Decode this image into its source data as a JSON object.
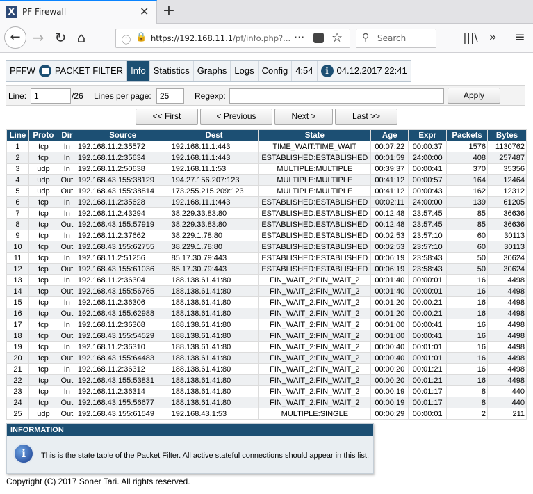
{
  "browser": {
    "tab_title": "PF Firewall",
    "url_host": "https://192.168.11.1",
    "url_path": "/pf/info.php?...",
    "search_placeholder": "Search"
  },
  "nav": {
    "brand": "PFFW",
    "menu_label": "PACKET FILTER",
    "tabs": [
      "Info",
      "Statistics",
      "Graphs",
      "Logs",
      "Config"
    ],
    "active_tab": "Info",
    "time": "4:54",
    "date": "04.12.2017 22:41"
  },
  "controls": {
    "line_label": "Line:",
    "line_value": "1",
    "line_total": "/26",
    "lines_per_page_label": "Lines per page:",
    "lines_per_page_value": "25",
    "regexp_label": "Regexp:",
    "regexp_value": "",
    "apply_label": "Apply"
  },
  "pager": {
    "first": "<< First",
    "previous": "< Previous",
    "next": "Next >",
    "last": "Last >>"
  },
  "table": {
    "headers": [
      "Line",
      "Proto",
      "Dir",
      "Source",
      "Dest",
      "State",
      "Age",
      "Expr",
      "Packets",
      "Bytes"
    ],
    "rows": [
      [
        "1",
        "tcp",
        "In",
        "192.168.11.2:35572",
        "192.168.11.1:443",
        "TIME_WAIT:TIME_WAIT",
        "00:07:22",
        "00:00:37",
        "1576",
        "1130762"
      ],
      [
        "2",
        "tcp",
        "In",
        "192.168.11.2:35634",
        "192.168.11.1:443",
        "ESTABLISHED:ESTABLISHED",
        "00:01:59",
        "24:00:00",
        "408",
        "257487"
      ],
      [
        "3",
        "udp",
        "In",
        "192.168.11.2:50638",
        "192.168.11.1:53",
        "MULTIPLE:MULTIPLE",
        "00:39:37",
        "00:00:41",
        "370",
        "35356"
      ],
      [
        "4",
        "udp",
        "Out",
        "192.168.43.155:38129",
        "194.27.156.207:123",
        "MULTIPLE:MULTIPLE",
        "00:41:12",
        "00:00:57",
        "164",
        "12464"
      ],
      [
        "5",
        "udp",
        "Out",
        "192.168.43.155:38814",
        "173.255.215.209:123",
        "MULTIPLE:MULTIPLE",
        "00:41:12",
        "00:00:43",
        "162",
        "12312"
      ],
      [
        "6",
        "tcp",
        "In",
        "192.168.11.2:35628",
        "192.168.11.1:443",
        "ESTABLISHED:ESTABLISHED",
        "00:02:11",
        "24:00:00",
        "139",
        "61205"
      ],
      [
        "7",
        "tcp",
        "In",
        "192.168.11.2:43294",
        "38.229.33.83:80",
        "ESTABLISHED:ESTABLISHED",
        "00:12:48",
        "23:57:45",
        "85",
        "36636"
      ],
      [
        "8",
        "tcp",
        "Out",
        "192.168.43.155:57919",
        "38.229.33.83:80",
        "ESTABLISHED:ESTABLISHED",
        "00:12:48",
        "23:57:45",
        "85",
        "36636"
      ],
      [
        "9",
        "tcp",
        "In",
        "192.168.11.2:37662",
        "38.229.1.78:80",
        "ESTABLISHED:ESTABLISHED",
        "00:02:53",
        "23:57:10",
        "60",
        "30113"
      ],
      [
        "10",
        "tcp",
        "Out",
        "192.168.43.155:62755",
        "38.229.1.78:80",
        "ESTABLISHED:ESTABLISHED",
        "00:02:53",
        "23:57:10",
        "60",
        "30113"
      ],
      [
        "11",
        "tcp",
        "In",
        "192.168.11.2:51256",
        "85.17.30.79:443",
        "ESTABLISHED:ESTABLISHED",
        "00:06:19",
        "23:58:43",
        "50",
        "30624"
      ],
      [
        "12",
        "tcp",
        "Out",
        "192.168.43.155:61036",
        "85.17.30.79:443",
        "ESTABLISHED:ESTABLISHED",
        "00:06:19",
        "23:58:43",
        "50",
        "30624"
      ],
      [
        "13",
        "tcp",
        "In",
        "192.168.11.2:36304",
        "188.138.61.41:80",
        "FIN_WAIT_2:FIN_WAIT_2",
        "00:01:40",
        "00:00:01",
        "16",
        "4498"
      ],
      [
        "14",
        "tcp",
        "Out",
        "192.168.43.155:56765",
        "188.138.61.41:80",
        "FIN_WAIT_2:FIN_WAIT_2",
        "00:01:40",
        "00:00:01",
        "16",
        "4498"
      ],
      [
        "15",
        "tcp",
        "In",
        "192.168.11.2:36306",
        "188.138.61.41:80",
        "FIN_WAIT_2:FIN_WAIT_2",
        "00:01:20",
        "00:00:21",
        "16",
        "4498"
      ],
      [
        "16",
        "tcp",
        "Out",
        "192.168.43.155:62988",
        "188.138.61.41:80",
        "FIN_WAIT_2:FIN_WAIT_2",
        "00:01:20",
        "00:00:21",
        "16",
        "4498"
      ],
      [
        "17",
        "tcp",
        "In",
        "192.168.11.2:36308",
        "188.138.61.41:80",
        "FIN_WAIT_2:FIN_WAIT_2",
        "00:01:00",
        "00:00:41",
        "16",
        "4498"
      ],
      [
        "18",
        "tcp",
        "Out",
        "192.168.43.155:54529",
        "188.138.61.41:80",
        "FIN_WAIT_2:FIN_WAIT_2",
        "00:01:00",
        "00:00:41",
        "16",
        "4498"
      ],
      [
        "19",
        "tcp",
        "In",
        "192.168.11.2:36310",
        "188.138.61.41:80",
        "FIN_WAIT_2:FIN_WAIT_2",
        "00:00:40",
        "00:01:01",
        "16",
        "4498"
      ],
      [
        "20",
        "tcp",
        "Out",
        "192.168.43.155:64483",
        "188.138.61.41:80",
        "FIN_WAIT_2:FIN_WAIT_2",
        "00:00:40",
        "00:01:01",
        "16",
        "4498"
      ],
      [
        "21",
        "tcp",
        "In",
        "192.168.11.2:36312",
        "188.138.61.41:80",
        "FIN_WAIT_2:FIN_WAIT_2",
        "00:00:20",
        "00:01:21",
        "16",
        "4498"
      ],
      [
        "22",
        "tcp",
        "Out",
        "192.168.43.155:53831",
        "188.138.61.41:80",
        "FIN_WAIT_2:FIN_WAIT_2",
        "00:00:20",
        "00:01:21",
        "16",
        "4498"
      ],
      [
        "23",
        "tcp",
        "In",
        "192.168.11.2:36314",
        "188.138.61.41:80",
        "FIN_WAIT_2:FIN_WAIT_2",
        "00:00:19",
        "00:01:17",
        "8",
        "440"
      ],
      [
        "24",
        "tcp",
        "Out",
        "192.168.43.155:56677",
        "188.138.61.41:80",
        "FIN_WAIT_2:FIN_WAIT_2",
        "00:00:19",
        "00:01:17",
        "8",
        "440"
      ],
      [
        "25",
        "udp",
        "Out",
        "192.168.43.155:61549",
        "192.168.43.1:53",
        "MULTIPLE:SINGLE",
        "00:00:29",
        "00:00:01",
        "2",
        "211"
      ]
    ]
  },
  "info_box": {
    "heading": "INFORMATION",
    "text": "This is the state table of the Packet Filter. All active stateful connections should appear in this list."
  },
  "footer": "Copyright (C) 2017 Soner Tari. All rights reserved.",
  "colors": {
    "header_blue": "#1c4f73",
    "row_alt": "#eef0f2"
  }
}
